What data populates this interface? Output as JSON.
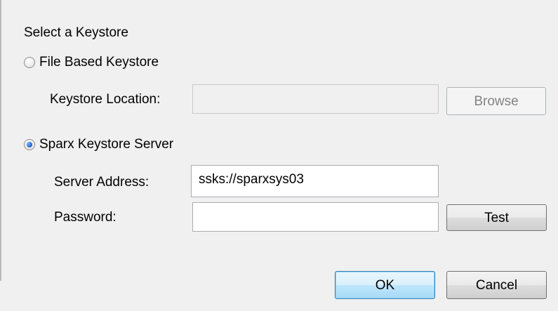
{
  "dialog": {
    "group_title": "Select a Keystore",
    "file_based": {
      "radio_label": "File Based Keystore",
      "selected": false,
      "location_label": "Keystore Location:",
      "location_value": "",
      "browse_label": "Browse"
    },
    "server": {
      "radio_label": "Sparx Keystore Server",
      "selected": true,
      "address_label": "Server Address:",
      "address_value": "ssks://sparxsys03",
      "password_label": "Password:",
      "password_value": "",
      "test_label": "Test"
    },
    "buttons": {
      "ok_label": "OK",
      "cancel_label": "Cancel"
    }
  }
}
